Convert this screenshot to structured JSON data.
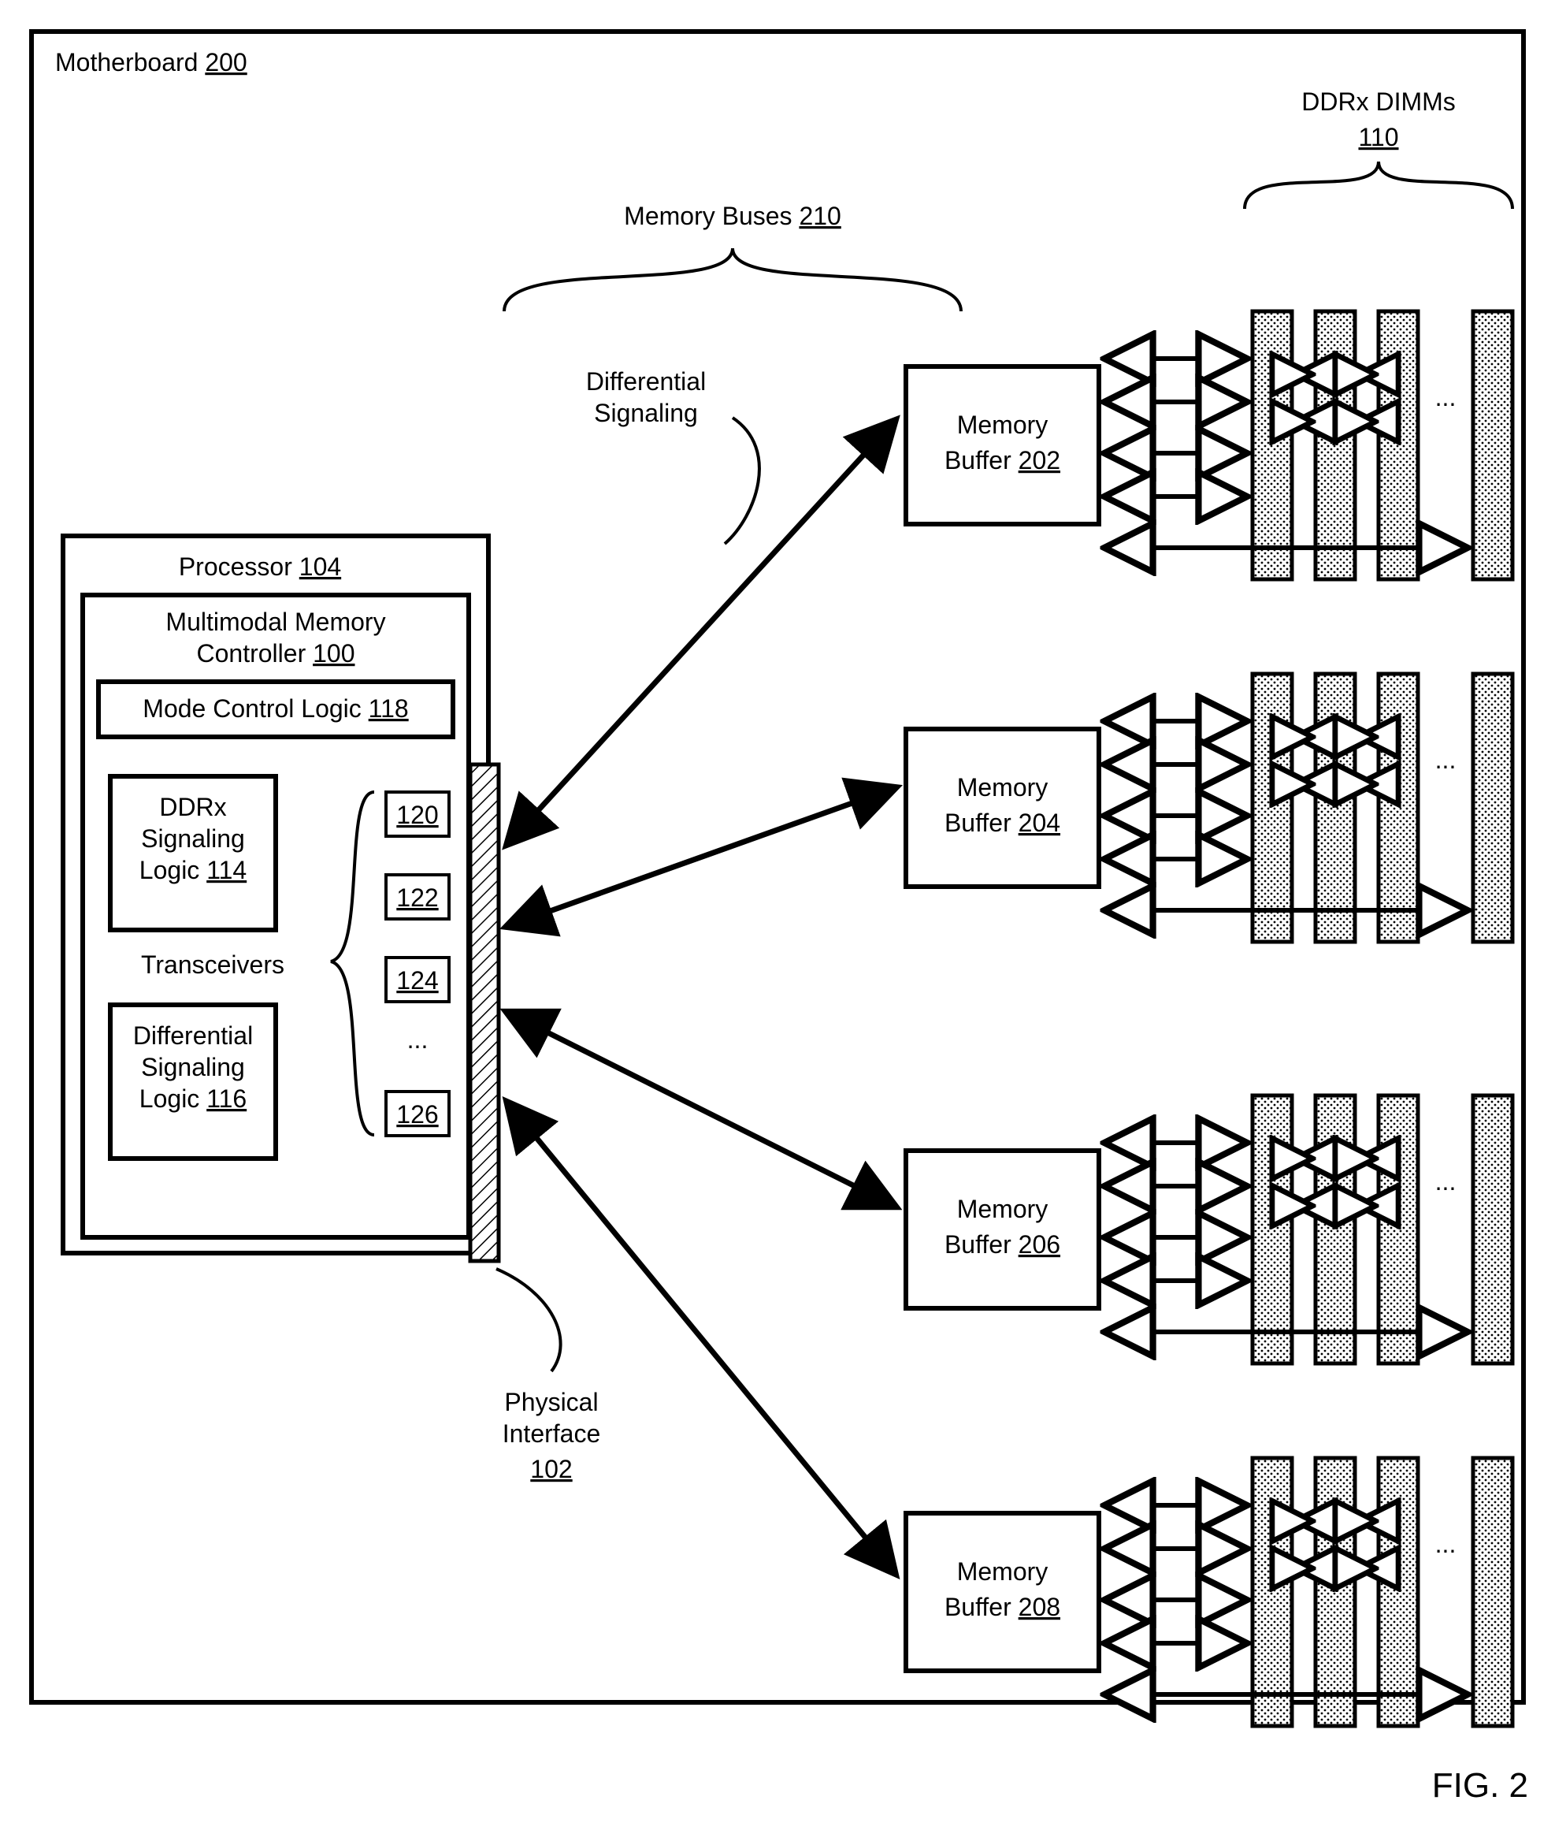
{
  "figure_label": "FIG. 2",
  "motherboard": {
    "label": "Motherboard",
    "ref": "200"
  },
  "processor": {
    "label": "Processor",
    "ref": "104"
  },
  "controller": {
    "label_line1": "Multimodal Memory",
    "label_line2": "Controller",
    "ref": "100"
  },
  "mode_logic": {
    "label": "Mode Control Logic",
    "ref": "118"
  },
  "ddrx_logic": {
    "line1": "DDRx",
    "line2": "Signaling",
    "line3": "Logic",
    "ref": "114"
  },
  "diff_logic": {
    "line1": "Differential",
    "line2": "Signaling",
    "line3": "Logic",
    "ref": "116"
  },
  "transceivers": {
    "label": "Transceivers",
    "items": [
      "120",
      "122",
      "124",
      "126"
    ],
    "ellipsis": "..."
  },
  "phys_if": {
    "line1": "Physical",
    "line2": "Interface",
    "ref": "102"
  },
  "diff_sig_label": {
    "label": "Differential",
    "label2": "Signaling"
  },
  "mem_buses": {
    "label": "Memory Buses",
    "ref": "210"
  },
  "dimms": {
    "label": "DDRx DIMMs",
    "ref": "110",
    "ellipsis": "..."
  },
  "buffers": [
    {
      "label": "Memory",
      "label2": "Buffer",
      "ref": "202"
    },
    {
      "label": "Memory",
      "label2": "Buffer",
      "ref": "204"
    },
    {
      "label": "Memory",
      "label2": "Buffer",
      "ref": "206"
    },
    {
      "label": "Memory",
      "label2": "Buffer",
      "ref": "208"
    }
  ]
}
